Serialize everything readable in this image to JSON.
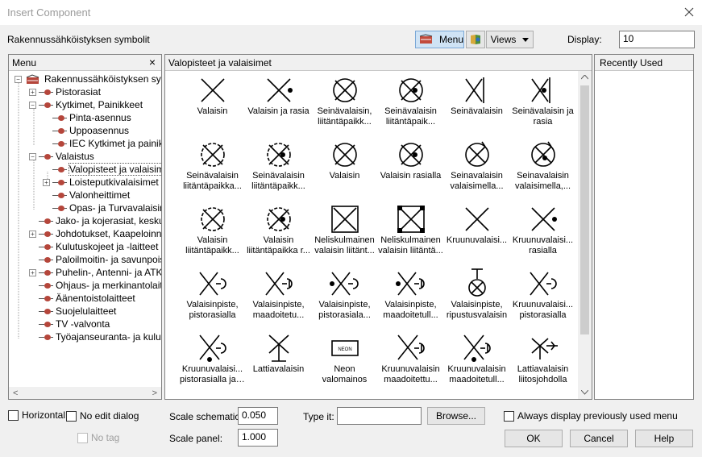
{
  "window": {
    "title": "Insert Component"
  },
  "header": {
    "library_name": "Rakennussähköistyksen symbolit",
    "menu_button": "Menu",
    "views_button": "Views",
    "display_label": "Display:",
    "display_value": "10"
  },
  "menu_panel": {
    "title": "Menu",
    "items": [
      {
        "label": "Rakennussähköistyksen symbo"
      },
      {
        "label": "Pistorasiat"
      },
      {
        "label": "Kytkimet, Painikkeet"
      },
      {
        "label": "Pinta-asennus"
      },
      {
        "label": "Uppoasennus"
      },
      {
        "label": "IEC Kytkimet ja painikk"
      },
      {
        "label": "Valaistus"
      },
      {
        "label": "Valopisteet ja valaisime"
      },
      {
        "label": "Loisteputkivalaisimet"
      },
      {
        "label": "Valonheittimet"
      },
      {
        "label": "Opas- ja Turvavalaisim"
      },
      {
        "label": "Jako- ja kojerasiat, keskuk"
      },
      {
        "label": "Johdotukset, Kaapeloinnit"
      },
      {
        "label": "Kulutuskojeet ja -laitteet"
      },
      {
        "label": "Paloilmoitin- ja savunpoisto"
      },
      {
        "label": "Puhelin-, Antenni- ja ATK-"
      },
      {
        "label": "Ohjaus- ja merkinantolaitte"
      },
      {
        "label": "Äänentoistolaitteet"
      },
      {
        "label": "Suojelulaitteet"
      },
      {
        "label": "TV -valvonta"
      },
      {
        "label": "Työajanseuranta- ja kulunv"
      }
    ]
  },
  "grid_panel": {
    "title": "Valopisteet ja valaisimet",
    "symbols": [
      {
        "line1": "Valaisin",
        "line2": ""
      },
      {
        "line1": "Valaisin ja rasia",
        "line2": ""
      },
      {
        "line1": "Seinävalaisin,",
        "line2": "liitäntäpaikk..."
      },
      {
        "line1": "Seinävalaisin",
        "line2": "liitäntäpaik..."
      },
      {
        "line1": "Seinävalaisin",
        "line2": ""
      },
      {
        "line1": "Seinävalaisin ja",
        "line2": "rasia"
      },
      {
        "line1": "Seinävalaisin",
        "line2": "liitäntäpaikka..."
      },
      {
        "line1": "Seinävalaisin",
        "line2": "liitäntäpaikk..."
      },
      {
        "line1": "Valaisin",
        "line2": ""
      },
      {
        "line1": "Valaisin rasialla",
        "line2": ""
      },
      {
        "line1": "Seinavalaisin",
        "line2": "valaisimella..."
      },
      {
        "line1": "Seinavalaisin",
        "line2": "valaisimella,..."
      },
      {
        "line1": "Valaisin",
        "line2": "liitäntäpaikk..."
      },
      {
        "line1": "Valaisin",
        "line2": "liitäntäpaikka r..."
      },
      {
        "line1": "Neliskulmainen",
        "line2": "valaisin liitänt..."
      },
      {
        "line1": "Neliskulmainen",
        "line2": "valaisin liitäntä..."
      },
      {
        "line1": "Kruunuvalaisi...",
        "line2": ""
      },
      {
        "line1": "Kruunuvalaisi...",
        "line2": "rasialla"
      },
      {
        "line1": "Valaisinpiste,",
        "line2": "pistorasialla"
      },
      {
        "line1": "Valaisinpiste,",
        "line2": "maadoitetu..."
      },
      {
        "line1": "Valaisinpiste,",
        "line2": "pistorasiala..."
      },
      {
        "line1": "Valaisinpiste,",
        "line2": "maadoitetull..."
      },
      {
        "line1": "Valaisinpiste,",
        "line2": "ripustusvalaisin"
      },
      {
        "line1": "Kruunuvalaisi...",
        "line2": "pistorasialla"
      },
      {
        "line1": "Kruunuvalaisi...",
        "line2": "pistorasialla ja ..."
      },
      {
        "line1": "Lattiavalaisin",
        "line2": ""
      },
      {
        "line1": "Neon",
        "line2": "valomainos",
        "glyph_text": "NEON"
      },
      {
        "line1": "Kruunuvalaisin",
        "line2": "maadoitettu..."
      },
      {
        "line1": "Kruunuvalaisin",
        "line2": "maadoitetull..."
      },
      {
        "line1": "Lattiavalaisin",
        "line2": "liitosjohdolla"
      }
    ]
  },
  "recent_panel": {
    "title": "Recently Used"
  },
  "bottom": {
    "horizontal_label": "Horizontal",
    "no_edit_dialog_label": "No edit dialog",
    "no_tag_label": "No tag",
    "scale_schematic_label": "Scale schematic:",
    "scale_schematic_value": "0.050",
    "scale_panel_label": "Scale panel:",
    "scale_panel_value": "1.000",
    "type_it_label": "Type it:",
    "type_it_value": "",
    "browse_button": "Browse...",
    "always_display_label": "Always display previously used menu",
    "ok_button": "OK",
    "cancel_button": "Cancel",
    "help_button": "Help"
  },
  "colors": {
    "title_text": "#9a9a9a",
    "selected_menu_button": "#cfe3f5",
    "icon_red": "#b5463b"
  }
}
